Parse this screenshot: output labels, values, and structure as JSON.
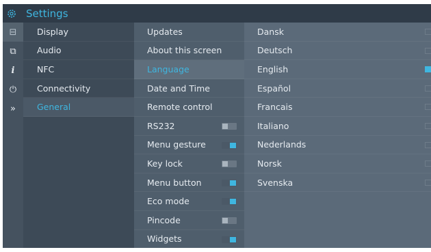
{
  "app": {
    "title": "Settings",
    "icon": "gear-icon"
  },
  "colors": {
    "accent": "#3fb6e0",
    "titlebar": "#2f3b48",
    "panel_dark": "#3d4a57",
    "panel_mid": "#4f5e6c",
    "panel_light": "#5b6a79"
  },
  "iconbar": [
    {
      "name": "display-icon",
      "glyph": "⊟"
    },
    {
      "name": "audio-icon",
      "glyph": "⧉"
    },
    {
      "name": "info-icon",
      "glyph": "i"
    },
    {
      "name": "power-icon",
      "glyph": "⏻"
    },
    {
      "name": "chevrons-right-icon",
      "glyph": "»"
    }
  ],
  "categories": [
    {
      "label": "Display"
    },
    {
      "label": "Audio"
    },
    {
      "label": "NFC"
    },
    {
      "label": "Connectivity"
    },
    {
      "label": "General",
      "selected": true
    }
  ],
  "general_items": [
    {
      "label": "Updates"
    },
    {
      "label": "About this screen"
    },
    {
      "label": "Language",
      "selected": true
    },
    {
      "label": "Date and Time"
    },
    {
      "label": "Remote control"
    },
    {
      "label": "RS232",
      "toggle": "off"
    },
    {
      "label": "Menu gesture",
      "toggle": "on"
    },
    {
      "label": "Key lock",
      "toggle": "off"
    },
    {
      "label": "Menu button",
      "toggle": "on"
    },
    {
      "label": "Eco mode",
      "toggle": "on"
    },
    {
      "label": "Pincode",
      "toggle": "off"
    },
    {
      "label": "Widgets",
      "toggle": "on"
    }
  ],
  "languages": [
    {
      "label": "Dansk",
      "selected": false
    },
    {
      "label": "Deutsch",
      "selected": false
    },
    {
      "label": "English",
      "selected": true
    },
    {
      "label": "Español",
      "selected": false
    },
    {
      "label": "Francais",
      "selected": false
    },
    {
      "label": "Italiano",
      "selected": false
    },
    {
      "label": "Nederlands",
      "selected": false
    },
    {
      "label": "Norsk",
      "selected": false
    },
    {
      "label": "Svenska",
      "selected": false
    }
  ]
}
